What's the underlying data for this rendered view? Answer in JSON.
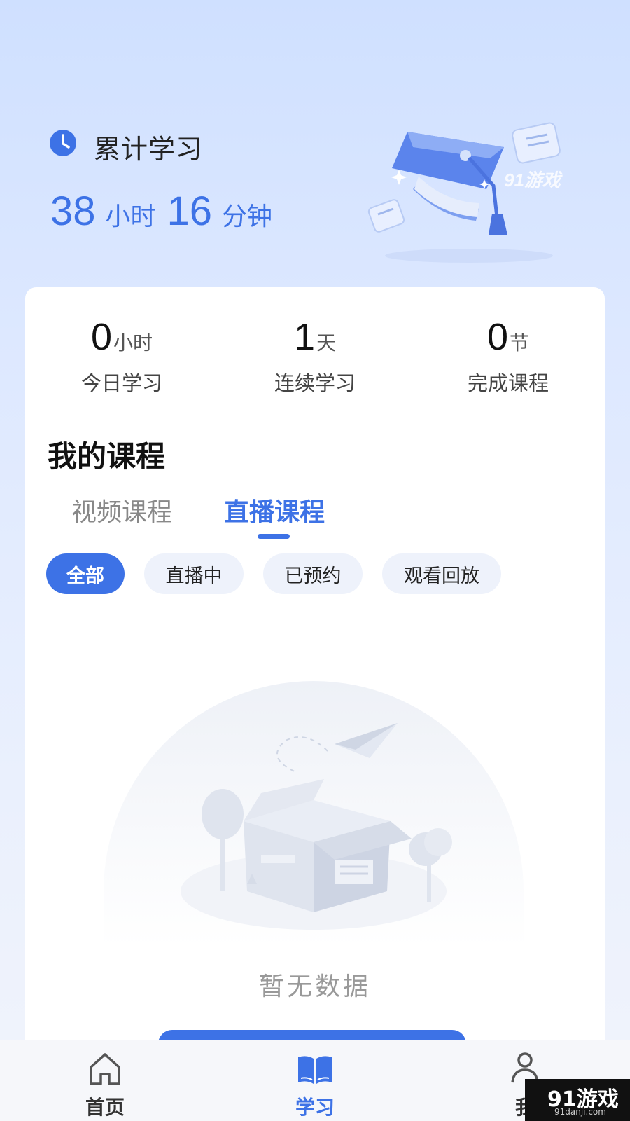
{
  "header": {
    "total_label": "累计学习",
    "hours": "38",
    "hours_unit": "小时",
    "minutes": "16",
    "minutes_unit": "分钟",
    "art_watermark": "91游戏"
  },
  "stats": [
    {
      "value": "0",
      "unit": "小时",
      "label": "今日学习"
    },
    {
      "value": "1",
      "unit": "天",
      "label": "连续学习"
    },
    {
      "value": "0",
      "unit": "节",
      "label": "完成课程"
    }
  ],
  "courses": {
    "title": "我的课程",
    "tabs": [
      {
        "label": "视频课程",
        "active": false
      },
      {
        "label": "直播课程",
        "active": true
      }
    ],
    "filters": [
      {
        "label": "全部",
        "active": true
      },
      {
        "label": "直播中",
        "active": false
      },
      {
        "label": "已预约",
        "active": false
      },
      {
        "label": "观看回放",
        "active": false
      }
    ],
    "empty_text": "暂无数据"
  },
  "nav": [
    {
      "label": "首页",
      "icon": "home-icon",
      "active": false
    },
    {
      "label": "学习",
      "icon": "book-icon",
      "active": true
    },
    {
      "label": "我",
      "icon": "user-icon",
      "active": false
    }
  ],
  "watermark": {
    "text": "91游戏",
    "sub": "91danji.com"
  },
  "colors": {
    "accent": "#3d72e6",
    "chip_bg": "#eef2fb",
    "background_top": "#cfe0ff"
  }
}
